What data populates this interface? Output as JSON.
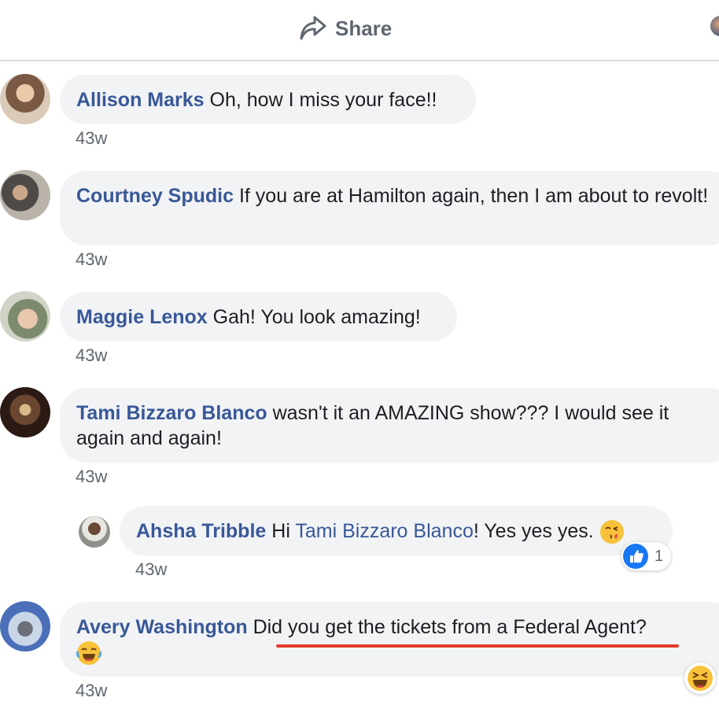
{
  "header": {
    "share_label": "Share"
  },
  "comments": [
    {
      "author": "Allison Marks",
      "text": "Oh, how I miss your face!!",
      "time": "43w"
    },
    {
      "author": "Courtney Spudic",
      "text": "If you are at Hamilton again, then I am about to revolt!",
      "time": "43w"
    },
    {
      "author": "Maggie Lenox",
      "text": "Gah! You look amazing!",
      "time": "43w"
    },
    {
      "author": "Tami Bizzaro Blanco",
      "text": "wasn't it an AMAZING show??? I would see it again and again!",
      "time": "43w"
    },
    {
      "author": "Ahsha Tribble",
      "text_before": "Hi",
      "mention": "Tami Bizzaro Blanco",
      "text_after": "! Yes yes yes.",
      "emoji": "face-blowing-kiss-icon",
      "time": "43w",
      "reactions": {
        "icon": "like-icon",
        "count": "1"
      }
    },
    {
      "author": "Avery Washington",
      "text": "Did you get the tickets from a Federal Agent?",
      "emoji": "laughing-tears-icon",
      "time": "43w",
      "reaction_icon": "laughing-squint-icon"
    }
  ],
  "colors": {
    "name_link": "#385898",
    "bubble_bg": "#f2f3f5",
    "annotation_underline": "#e53a2c",
    "like_blue": "#1877f2"
  }
}
